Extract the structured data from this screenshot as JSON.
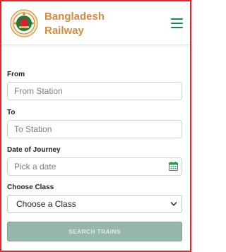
{
  "header": {
    "brand_line1": "Bangladesh",
    "brand_line2": "Railway",
    "logo_icon": "bangladesh-railway-logo",
    "menu_icon": "hamburger-menu-icon"
  },
  "form": {
    "from_label": "From",
    "from_placeholder": "From Station",
    "to_label": "To",
    "to_placeholder": "To Station",
    "date_label": "Date of Journey",
    "date_placeholder": "Pick a date",
    "calendar_icon": "calendar-icon",
    "class_label": "Choose Class",
    "class_selected": "Choose a Class",
    "search_label": "SEARCH TRAINS"
  },
  "colors": {
    "brand": "#d98a3d",
    "menu": "#15884c",
    "button": "#95b5ad",
    "frame": "#e3262b"
  }
}
